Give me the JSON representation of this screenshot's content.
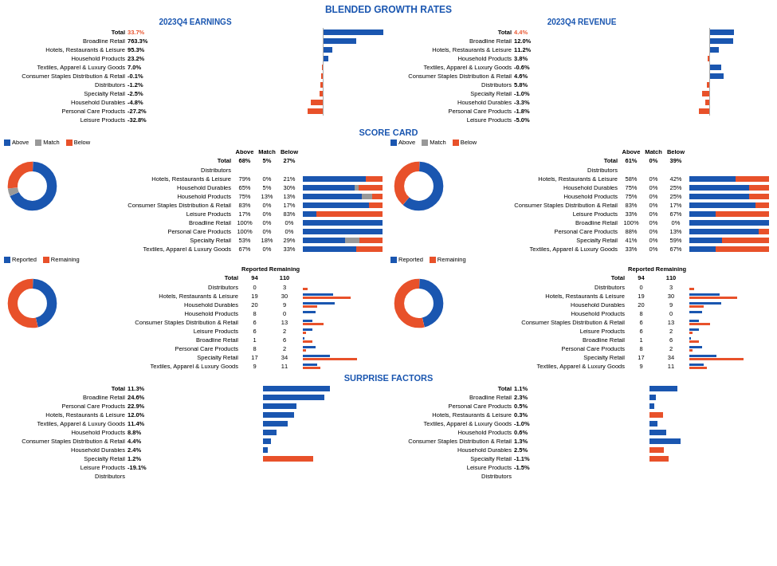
{
  "title": "BLENDED GROWTH RATES",
  "scorecard_title": "SCORE CARD",
  "surprise_title": "SURPRISE FACTORS",
  "earnings_title": "2023Q4 EARNINGS",
  "revenue_title": "2023Q4 REVENUE",
  "legend": {
    "above": "Above",
    "match": "Match",
    "below": "Below",
    "reported": "Reported",
    "remaining": "Remaining"
  },
  "earnings": {
    "total_label": "Total",
    "total_value": "33.7%",
    "rows": [
      {
        "label": "Broadline Retail",
        "value": "763.3%",
        "bar": 100,
        "pos": true
      },
      {
        "label": "Hotels, Restaurants & Leisure",
        "value": "95.3%",
        "bar": 55,
        "pos": true
      },
      {
        "label": "Household Products",
        "value": "23.2%",
        "bar": 15,
        "pos": true
      },
      {
        "label": "Textiles, Apparel & Luxury Goods",
        "value": "7.0%",
        "bar": 8,
        "pos": true
      },
      {
        "label": "Consumer Staples Distribution & Retail",
        "value": "-0.1%",
        "bar": 2,
        "pos": false
      },
      {
        "label": "Distributors",
        "value": "-1.2%",
        "bar": 3,
        "pos": false
      },
      {
        "label": "Specialty Retail",
        "value": "-2.5%",
        "bar": 4,
        "pos": false
      },
      {
        "label": "Household Durables",
        "value": "-4.8%",
        "bar": 6,
        "pos": false
      },
      {
        "label": "Personal Care Products",
        "value": "-27.2%",
        "bar": 20,
        "pos": false
      },
      {
        "label": "Leisure Products",
        "value": "-32.8%",
        "bar": 25,
        "pos": false
      }
    ]
  },
  "revenue": {
    "total_label": "Total",
    "total_value": "4.4%",
    "rows": [
      {
        "label": "Broadline Retail",
        "value": "12.0%",
        "bar": 40,
        "pos": true
      },
      {
        "label": "Hotels, Restaurants & Leisure",
        "value": "11.2%",
        "bar": 38,
        "pos": true
      },
      {
        "label": "Household Products",
        "value": "3.8%",
        "bar": 15,
        "pos": true
      },
      {
        "label": "Textiles, Apparel & Luxury Goods",
        "value": "-0.6%",
        "bar": 3,
        "pos": false
      },
      {
        "label": "Consumer Staples Distribution & Retail",
        "value": "4.6%",
        "bar": 18,
        "pos": true
      },
      {
        "label": "Distributors",
        "value": "5.8%",
        "bar": 22,
        "pos": true
      },
      {
        "label": "Specialty Retail",
        "value": "-1.0%",
        "bar": 4,
        "pos": false
      },
      {
        "label": "Household Durables",
        "value": "-3.3%",
        "bar": 12,
        "pos": false
      },
      {
        "label": "Personal Care Products",
        "value": "-1.8%",
        "bar": 7,
        "pos": false
      },
      {
        "label": "Leisure Products",
        "value": "-5.0%",
        "bar": 18,
        "pos": false
      }
    ]
  },
  "scorecard_earnings": {
    "total": {
      "above": "68%",
      "match": "5%",
      "below": "27%"
    },
    "rows": [
      {
        "label": "Distributors",
        "above": "",
        "match": "",
        "below": "",
        "ab": 0,
        "ma": 0,
        "be": 0
      },
      {
        "label": "Hotels, Restaurants & Leisure",
        "above": "79%",
        "match": "0%",
        "below": "21%",
        "ab": 79,
        "ma": 0,
        "be": 21
      },
      {
        "label": "Household Durables",
        "above": "65%",
        "match": "5%",
        "below": "30%",
        "ab": 65,
        "ma": 5,
        "be": 30
      },
      {
        "label": "Household Products",
        "above": "75%",
        "match": "13%",
        "below": "13%",
        "ab": 75,
        "ma": 13,
        "be": 13
      },
      {
        "label": "Consumer Staples Distribution & Retail",
        "above": "83%",
        "match": "0%",
        "below": "17%",
        "ab": 83,
        "ma": 0,
        "be": 17
      },
      {
        "label": "Leisure Products",
        "above": "17%",
        "match": "0%",
        "below": "83%",
        "ab": 17,
        "ma": 0,
        "be": 83
      },
      {
        "label": "Broadline Retail",
        "above": "100%",
        "match": "0%",
        "below": "0%",
        "ab": 100,
        "ma": 0,
        "be": 0
      },
      {
        "label": "Personal Care Products",
        "above": "100%",
        "match": "0%",
        "below": "0%",
        "ab": 100,
        "ma": 0,
        "be": 0
      },
      {
        "label": "Specialty Retail",
        "above": "53%",
        "match": "18%",
        "below": "29%",
        "ab": 53,
        "ma": 18,
        "be": 29
      },
      {
        "label": "Textiles, Apparel & Luxury Goods",
        "above": "67%",
        "match": "0%",
        "below": "33%",
        "ab": 67,
        "ma": 0,
        "be": 33
      }
    ],
    "donut": {
      "above": 68,
      "match": 5,
      "below": 27
    }
  },
  "scorecard_revenue": {
    "total": {
      "above": "61%",
      "match": "0%",
      "below": "39%"
    },
    "rows": [
      {
        "label": "Distributors",
        "above": "",
        "match": "",
        "below": "",
        "ab": 0,
        "ma": 0,
        "be": 0
      },
      {
        "label": "Hotels, Restaurants & Leisure",
        "above": "58%",
        "match": "0%",
        "below": "42%",
        "ab": 58,
        "ma": 0,
        "be": 42
      },
      {
        "label": "Household Durables",
        "above": "75%",
        "match": "0%",
        "below": "25%",
        "ab": 75,
        "ma": 0,
        "be": 25
      },
      {
        "label": "Household Products",
        "above": "75%",
        "match": "0%",
        "below": "25%",
        "ab": 75,
        "ma": 0,
        "be": 25
      },
      {
        "label": "Consumer Staples Distribution & Retail",
        "above": "83%",
        "match": "0%",
        "below": "17%",
        "ab": 83,
        "ma": 0,
        "be": 17
      },
      {
        "label": "Leisure Products",
        "above": "33%",
        "match": "0%",
        "below": "67%",
        "ab": 33,
        "ma": 0,
        "be": 67
      },
      {
        "label": "Broadline Retail",
        "above": "100%",
        "match": "0%",
        "below": "0%",
        "ab": 100,
        "ma": 0,
        "be": 0
      },
      {
        "label": "Personal Care Products",
        "above": "88%",
        "match": "0%",
        "below": "13%",
        "ab": 88,
        "ma": 0,
        "be": 13
      },
      {
        "label": "Specialty Retail",
        "above": "41%",
        "match": "0%",
        "below": "59%",
        "ab": 41,
        "ma": 0,
        "be": 59
      },
      {
        "label": "Textiles, Apparel & Luxury Goods",
        "above": "33%",
        "match": "0%",
        "below": "67%",
        "ab": 33,
        "ma": 0,
        "be": 67
      }
    ],
    "donut": {
      "above": 61,
      "match": 0,
      "below": 39
    }
  },
  "reported_earnings": {
    "total": {
      "reported": "94",
      "remaining": "110"
    },
    "rows": [
      {
        "label": "Distributors",
        "reported": "0",
        "remaining": "3"
      },
      {
        "label": "Hotels, Restaurants & Leisure",
        "reported": "19",
        "remaining": "30"
      },
      {
        "label": "Household Durables",
        "reported": "20",
        "remaining": "9"
      },
      {
        "label": "Household Products",
        "reported": "8",
        "remaining": "0"
      },
      {
        "label": "Consumer Staples Distribution & Retail",
        "reported": "6",
        "remaining": "13"
      },
      {
        "label": "Leisure Products",
        "reported": "6",
        "remaining": "2"
      },
      {
        "label": "Broadline Retail",
        "reported": "1",
        "remaining": "6"
      },
      {
        "label": "Personal Care Products",
        "reported": "8",
        "remaining": "2"
      },
      {
        "label": "Specialty Retail",
        "reported": "17",
        "remaining": "34"
      },
      {
        "label": "Textiles, Apparel & Luxury Goods",
        "reported": "9",
        "remaining": "11"
      }
    ]
  },
  "reported_revenue": {
    "total": {
      "reported": "94",
      "remaining": "110"
    },
    "rows": [
      {
        "label": "Distributors",
        "reported": "0",
        "remaining": "3"
      },
      {
        "label": "Hotels, Restaurants & Leisure",
        "reported": "19",
        "remaining": "30"
      },
      {
        "label": "Household Durables",
        "reported": "20",
        "remaining": "9"
      },
      {
        "label": "Household Products",
        "reported": "8",
        "remaining": "0"
      },
      {
        "label": "Consumer Staples Distribution & Retail",
        "reported": "6",
        "remaining": "13"
      },
      {
        "label": "Leisure Products",
        "reported": "6",
        "remaining": "2"
      },
      {
        "label": "Broadline Retail",
        "reported": "1",
        "remaining": "6"
      },
      {
        "label": "Personal Care Products",
        "reported": "8",
        "remaining": "2"
      },
      {
        "label": "Specialty Retail",
        "reported": "17",
        "remaining": "34"
      },
      {
        "label": "Textiles, Apparel & Luxury Goods",
        "reported": "9",
        "remaining": "11"
      }
    ]
  },
  "surprise_earnings": {
    "total_label": "Total",
    "total_value": "11.3%",
    "rows": [
      {
        "label": "Broadline Retail",
        "value": "24.6%",
        "bar": 60,
        "pos": true
      },
      {
        "label": "Personal Care Products",
        "value": "22.9%",
        "bar": 55,
        "pos": true
      },
      {
        "label": "Hotels, Restaurants & Leisure",
        "value": "12.0%",
        "bar": 30,
        "pos": true
      },
      {
        "label": "Textiles, Apparel & Luxury Goods",
        "value": "11.4%",
        "bar": 28,
        "pos": true
      },
      {
        "label": "Household Products",
        "value": "8.8%",
        "bar": 22,
        "pos": true
      },
      {
        "label": "Consumer Staples Distribution & Retail",
        "value": "4.4%",
        "bar": 12,
        "pos": true
      },
      {
        "label": "Household Durables",
        "value": "2.4%",
        "bar": 7,
        "pos": true
      },
      {
        "label": "Specialty Retail",
        "value": "1.2%",
        "bar": 4,
        "pos": true
      },
      {
        "label": "Leisure Products",
        "value": "-19.1%",
        "bar": 45,
        "pos": false
      },
      {
        "label": "Distributors",
        "value": "",
        "bar": 0,
        "pos": true
      }
    ]
  },
  "surprise_revenue": {
    "total_label": "Total",
    "total_value": "1.1%",
    "rows": [
      {
        "label": "Broadline Retail",
        "value": "2.3%",
        "bar": 25,
        "pos": true
      },
      {
        "label": "Personal Care Products",
        "value": "0.5%",
        "bar": 6,
        "pos": true
      },
      {
        "label": "Hotels, Restaurants & Leisure",
        "value": "0.3%",
        "bar": 4,
        "pos": true
      },
      {
        "label": "Textiles, Apparel & Luxury Goods",
        "value": "-1.0%",
        "bar": 12,
        "pos": false
      },
      {
        "label": "Household Products",
        "value": "0.6%",
        "bar": 7,
        "pos": true
      },
      {
        "label": "Consumer Staples Distribution & Retail",
        "value": "1.3%",
        "bar": 15,
        "pos": true
      },
      {
        "label": "Household Durables",
        "value": "2.5%",
        "bar": 28,
        "pos": true
      },
      {
        "label": "Specialty Retail",
        "value": "-1.1%",
        "bar": 13,
        "pos": false
      },
      {
        "label": "Leisure Products",
        "value": "-1.5%",
        "bar": 17,
        "pos": false
      },
      {
        "label": "Distributors",
        "value": "",
        "bar": 0,
        "pos": true
      }
    ]
  }
}
